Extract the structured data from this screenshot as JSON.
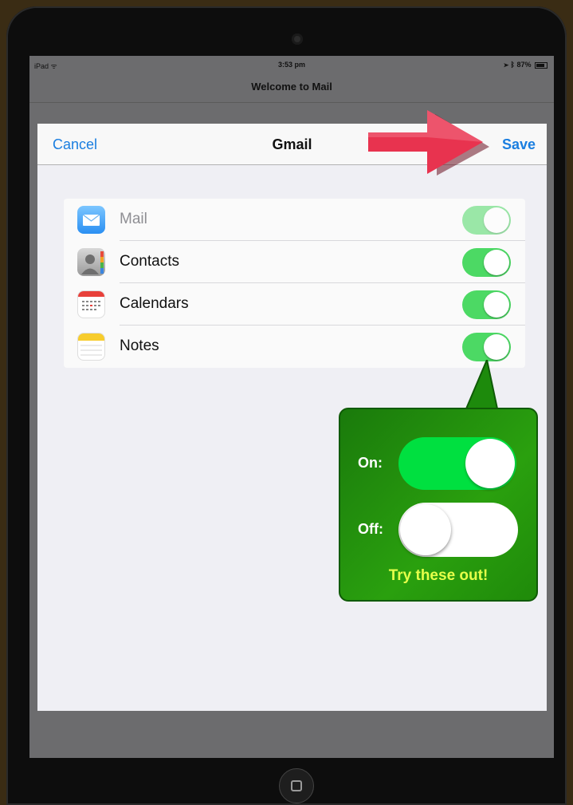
{
  "status_bar": {
    "device": "iPad",
    "time": "3:53 pm",
    "battery": "87%"
  },
  "background_title": "Welcome to Mail",
  "sheet": {
    "cancel_label": "Cancel",
    "title": "Gmail",
    "save_label": "Save"
  },
  "settings": [
    {
      "label": "Mail",
      "icon": "mail-icon",
      "enabled": false,
      "on": true
    },
    {
      "label": "Contacts",
      "icon": "contacts-icon",
      "enabled": true,
      "on": true
    },
    {
      "label": "Calendars",
      "icon": "calendar-icon",
      "enabled": true,
      "on": true
    },
    {
      "label": "Notes",
      "icon": "notes-icon",
      "enabled": true,
      "on": true
    }
  ],
  "callout": {
    "on_label": "On:",
    "off_label": "Off:",
    "caption": "Try these out!"
  },
  "colors": {
    "accent": "#1a7ee0",
    "toggle_on": "#4cd964",
    "callout_green": "#2aa00e",
    "callout_text": "#e6ff4a",
    "arrow": "#e8334f"
  }
}
